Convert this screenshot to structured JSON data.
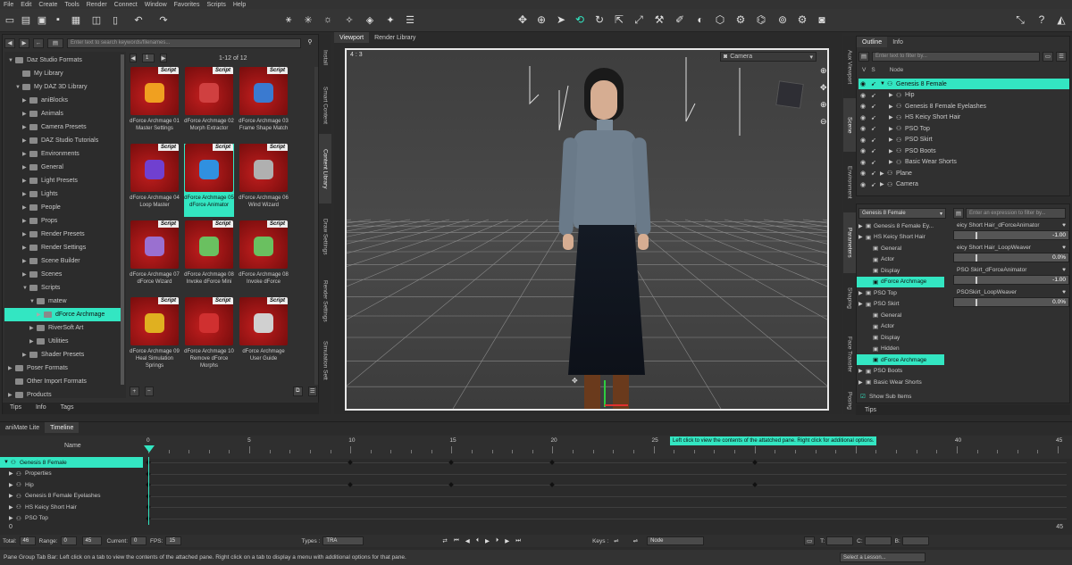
{
  "menu": [
    "File",
    "Edit",
    "Create",
    "Tools",
    "Render",
    "Connect",
    "Window",
    "Favorites",
    "Scripts",
    "Help"
  ],
  "content_library": {
    "search_placeholder": "Enter text to search keywords/filenames...",
    "page": "1",
    "count": "1-12 of 12",
    "tree": [
      {
        "label": "Daz Studio Formats",
        "indent": 0,
        "arrow": "▼"
      },
      {
        "label": "My Library",
        "indent": 1,
        "arrow": ""
      },
      {
        "label": "My DAZ 3D Library",
        "indent": 1,
        "arrow": "▼"
      },
      {
        "label": "aniBlocks",
        "indent": 2,
        "arrow": "▶"
      },
      {
        "label": "Animals",
        "indent": 2,
        "arrow": "▶"
      },
      {
        "label": "Camera Presets",
        "indent": 2,
        "arrow": "▶"
      },
      {
        "label": "DAZ Studio Tutorials",
        "indent": 2,
        "arrow": "▶"
      },
      {
        "label": "Environments",
        "indent": 2,
        "arrow": "▶"
      },
      {
        "label": "General",
        "indent": 2,
        "arrow": "▶"
      },
      {
        "label": "Light Presets",
        "indent": 2,
        "arrow": "▶"
      },
      {
        "label": "Lights",
        "indent": 2,
        "arrow": "▶"
      },
      {
        "label": "People",
        "indent": 2,
        "arrow": "▶"
      },
      {
        "label": "Props",
        "indent": 2,
        "arrow": "▶"
      },
      {
        "label": "Render Presets",
        "indent": 2,
        "arrow": "▶"
      },
      {
        "label": "Render Settings",
        "indent": 2,
        "arrow": "▶"
      },
      {
        "label": "Scene Builder",
        "indent": 2,
        "arrow": "▶"
      },
      {
        "label": "Scenes",
        "indent": 2,
        "arrow": "▶"
      },
      {
        "label": "Scripts",
        "indent": 2,
        "arrow": "▼"
      },
      {
        "label": "matew",
        "indent": 3,
        "arrow": "▼"
      },
      {
        "label": "dForce Archmage",
        "indent": 4,
        "arrow": "▶",
        "selected": true
      },
      {
        "label": "RiverSoft Art",
        "indent": 3,
        "arrow": "▶"
      },
      {
        "label": "Utilities",
        "indent": 3,
        "arrow": "▶"
      },
      {
        "label": "Shader Presets",
        "indent": 2,
        "arrow": "▶"
      },
      {
        "label": "Poser Formats",
        "indent": 0,
        "arrow": "▶"
      },
      {
        "label": "Other Import Formats",
        "indent": 0,
        "arrow": ""
      },
      {
        "label": "Products",
        "indent": 0,
        "arrow": "▶"
      }
    ],
    "items": [
      {
        "label": "dForce Archmage 01 Master Settings",
        "tag": "Script",
        "icon": "#f0a020"
      },
      {
        "label": "dForce Archmage 02 Morph Extractor",
        "tag": "Script",
        "icon": "#d04040"
      },
      {
        "label": "dForce Archmage 03 Frame Shape Match",
        "tag": "Script",
        "icon": "#3a7ad0"
      },
      {
        "label": "dForce Archmage 04 Loop Master",
        "tag": "Script",
        "icon": "#7040d0"
      },
      {
        "label": "dForce Archmage 05 dForce Animator",
        "tag": "Script",
        "icon": "#3090e0",
        "selected": true
      },
      {
        "label": "dForce Archmage 06 Wind Wizard",
        "tag": "Script",
        "icon": "#b0b0b0"
      },
      {
        "label": "dForce Archmage 07 dForce Wizard",
        "tag": "Script",
        "icon": "#9a70d0"
      },
      {
        "label": "dForce Archmage 08 Invoke dForce Mini",
        "tag": "Script",
        "icon": "#6ac060"
      },
      {
        "label": "dForce Archmage 08 Invoke dForce",
        "tag": "Script",
        "icon": "#6ac060"
      },
      {
        "label": "dForce Archmage 09 Heal Simulation Springs",
        "tag": "Script",
        "icon": "#e0b020"
      },
      {
        "label": "dForce Archmage 10 Remove dForce Morphs",
        "tag": "Script",
        "icon": "#d03030"
      },
      {
        "label": "dForce Archmage User Guide",
        "tag": "Script",
        "icon": "#d0d0d0"
      }
    ],
    "bottom_tabs": [
      "Tips",
      "Info",
      "Tags"
    ]
  },
  "side_tabs_left": [
    "Install",
    "Smart Content",
    "Content Library",
    "Draw Settings",
    "Render Settings",
    "Simulation Sett"
  ],
  "viewport": {
    "tabs": [
      "Viewport",
      "Render Library"
    ],
    "aspect": "4 : 3",
    "camera": "Camera"
  },
  "scene": {
    "tabs": [
      "Outline",
      "Info"
    ],
    "filter_placeholder": "Enter text to filter by...",
    "header": [
      "V",
      "S",
      "Node"
    ],
    "nodes": [
      {
        "label": "Genesis 8 Female",
        "indent": 0,
        "selected": true
      },
      {
        "label": "Hip",
        "indent": 1
      },
      {
        "label": "Genesis 8 Female Eyelashes",
        "indent": 1
      },
      {
        "label": "HS Keicy Short Hair",
        "indent": 1
      },
      {
        "label": "PSO Top",
        "indent": 1
      },
      {
        "label": "PSO Skirt",
        "indent": 1
      },
      {
        "label": "PSO Boots",
        "indent": 1
      },
      {
        "label": "Basic Wear Shorts",
        "indent": 1
      },
      {
        "label": "Plane",
        "indent": 0
      },
      {
        "label": "Camera",
        "indent": 0
      }
    ]
  },
  "side_tabs_right": [
    "Aux Viewport",
    "Scene",
    "Environment",
    "Parameters",
    "Shaping",
    "Face Transfer",
    "Posing"
  ],
  "parameters": {
    "node_select": "Genesis 8 Female",
    "filter_placeholder": "Enter an expression to filter by...",
    "tree": [
      {
        "label": "Genesis 8 Female Ey...",
        "indent": 0
      },
      {
        "label": "HS Keicy Short Hair",
        "indent": 0
      },
      {
        "label": "General",
        "indent": 1
      },
      {
        "label": "Actor",
        "indent": 1
      },
      {
        "label": "Display",
        "indent": 1
      },
      {
        "label": "dForce Archmage",
        "indent": 1,
        "selected": true
      },
      {
        "label": "PSO Top",
        "indent": 0
      },
      {
        "label": "PSO Skirt",
        "indent": 0
      },
      {
        "label": "General",
        "indent": 1
      },
      {
        "label": "Actor",
        "indent": 1
      },
      {
        "label": "Display",
        "indent": 1
      },
      {
        "label": "Hidden",
        "indent": 1
      },
      {
        "label": "dForce Archmage",
        "indent": 1,
        "selected": true
      },
      {
        "label": "PSO Boots",
        "indent": 0
      },
      {
        "label": "Basic Wear Shorts",
        "indent": 0
      }
    ],
    "show_sub_items": "Show Sub Items",
    "props": [
      {
        "label": "eicy Short Hair_dForceAnimator",
        "value": "-1.00"
      },
      {
        "label": "eicy Short Hair_LoopWeaver",
        "value": "0.0%"
      },
      {
        "label": "PSO Skirt_dForceAnimator",
        "value": "-1.00"
      },
      {
        "label": "PSOSkirt_LoopWeaver",
        "value": "0.0%"
      }
    ],
    "bottom_tab": "Tips"
  },
  "timeline": {
    "tabs": [
      "aniMate Lite",
      "Timeline"
    ],
    "name_header": "Name",
    "ticks": [
      "0",
      "5",
      "10",
      "15",
      "20",
      "25",
      "30",
      "35",
      "40",
      "45"
    ],
    "tooltip": "Left click to view the contents of the attatched pane. Right click for additional options.",
    "rows": [
      "Genesis 8 Female",
      "Properties",
      "Hip",
      "Genesis 8 Female Eyelashes",
      "HS Keicy Short Hair",
      "PSO Top"
    ],
    "range_start": "0",
    "range_end": "45",
    "total_label": "Total:",
    "total": "46",
    "range_label": "Range:",
    "range_from": "0",
    "range_to": "45",
    "current_label": "Current:",
    "current": "0",
    "fps_label": "FPS:",
    "fps": "15",
    "types_label": "Types :",
    "types": "TRA",
    "keys_label": "Keys :",
    "node": "Node",
    "t_label": "T:",
    "c_label": "C:",
    "b_label": "B:"
  },
  "status": {
    "message": "Pane Group Tab Bar: Left click on a tab to view the contents of the attached pane. Right click on a tab to display a menu with additional options for that pane.",
    "lesson": "Select a Lesson..."
  },
  "accent": "#33e6c2"
}
